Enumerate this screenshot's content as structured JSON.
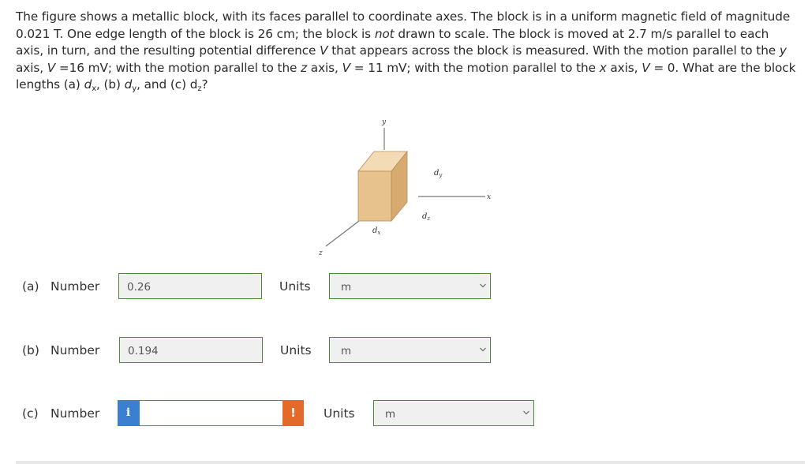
{
  "question": {
    "p1": "The figure shows a metallic block, with its faces parallel to coordinate axes. The block is in a uniform magnetic field of magnitude 0.021 T. One edge length of the block is 26 cm; the block is ",
    "not": "not",
    "p2": " drawn to scale. The block is moved at 2.7 m/s parallel to each axis, in turn, and the resulting potential difference ",
    "V1": "V",
    "p3": " that appears across the block is measured. With the motion parallel to the ",
    "y": "y",
    "p4": " axis, ",
    "V2": "V",
    "p5": " =16 mV; with the motion parallel to the ",
    "z": "z",
    "p6": " axis, ",
    "V3": "V",
    "p7": " = 11 mV; with the motion parallel to the ",
    "x": "x",
    "p8": " axis, ",
    "V4": "V",
    "p9": " = 0. What are the block lengths (a) ",
    "dx_d": "d",
    "dx_s": "x",
    "p10": ", (b) ",
    "dy_d": "d",
    "dy_s": "y",
    "p11": ", and (c) ",
    "dz_d": "d",
    "dz_s": "z",
    "p12": "?"
  },
  "figure": {
    "axis_y": "y",
    "axis_x": "x",
    "axis_z": "z",
    "label_dx": "d",
    "label_dx_sub": "x",
    "label_dy": "d",
    "label_dy_sub": "y",
    "label_dz": "d",
    "label_dz_sub": "z",
    "colors": {
      "front": "#e8c28d",
      "top": "#f3dcb5",
      "side": "#d7ab70",
      "edge": "#b88a52"
    }
  },
  "answers": [
    {
      "part": "(a)",
      "label": "Number",
      "value": "0.26",
      "units_label": "Units",
      "unit": "m"
    },
    {
      "part": "(b)",
      "label": "Number",
      "value": "0.194",
      "units_label": "Units",
      "unit": "m"
    },
    {
      "part": "(c)",
      "label": "Number",
      "value": "",
      "units_label": "Units",
      "unit": "m",
      "info_icon": "i",
      "warn_icon": "!"
    }
  ]
}
